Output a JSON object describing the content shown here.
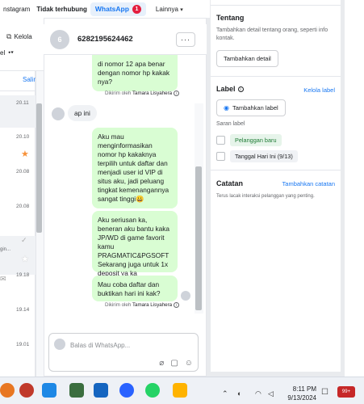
{
  "topbar": {
    "tab_instagram": "nstagram",
    "tab_unanswered": "Tidak terhubung",
    "tab_whatsapp": "WhatsApp",
    "whatsapp_badge": "1",
    "tab_more": "Lainnya"
  },
  "left": {
    "manage_label": "Kelola",
    "filter_label": "el",
    "copy_label": "Salin",
    "times": [
      "20.11",
      "20.10",
      "20.08",
      "20.08",
      "",
      "19.18",
      "19.14",
      "19.01"
    ],
    "row_snippet": "gin..."
  },
  "chat": {
    "avatar_letter": "6",
    "phone": "6282195624462",
    "more_label": "···",
    "messages": [
      {
        "dir": "out",
        "text": "di nomor 12 apa benar dengan nomor hp kakak nya?"
      },
      {
        "dir": "meta",
        "text": "Dikirim oleh",
        "author": "Tamara Lisyahera"
      },
      {
        "dir": "in",
        "text": "ap ini"
      },
      {
        "dir": "out",
        "text": "Aku mau menginformasikan nomor hp kakaknya terpilih untuk daftar dan menjadi user id VIP di situs aku, jadi peluang tingkat kemenangannya sangat tinggi😀"
      },
      {
        "dir": "out",
        "text": "Aku seriusan ka, beneran aku bantu kaka JP/WD di game favorit kamu PRAGMATIC&PGSOFT Sekarang juga untuk 1x deposit ya ka"
      },
      {
        "dir": "out",
        "text": "Mau coba daftar dan buktikan hari ini kak?"
      },
      {
        "dir": "meta",
        "text": "Dikirim oleh",
        "author": "Tamara Lisyahera"
      }
    ],
    "composer_placeholder": "Balas di WhatsApp..."
  },
  "right": {
    "about_title": "Tentang",
    "about_text": "Tambahkan detail tentang orang, seperti info kontak.",
    "add_detail_button": "Tambahkan detail",
    "label_title": "Label",
    "manage_labels_link": "Kelola label",
    "add_label_button": "Tambahkan label",
    "suggested_title": "Saran label",
    "suggested": [
      "Pelanggan baru",
      "Tanggal Hari Ini (9/13)"
    ],
    "notes_title": "Catatan",
    "add_note_link": "Tambahkan catatan",
    "notes_text": "Terus lacak interaksi pelanggan yang penting."
  },
  "taskbar": {
    "time": "8:11 PM",
    "date": "9/13/2024",
    "badge_count": "99+"
  },
  "colors": {
    "accent": "#1877f2",
    "bubble_out": "#d9fdd3",
    "badge": "#e41e3f"
  }
}
